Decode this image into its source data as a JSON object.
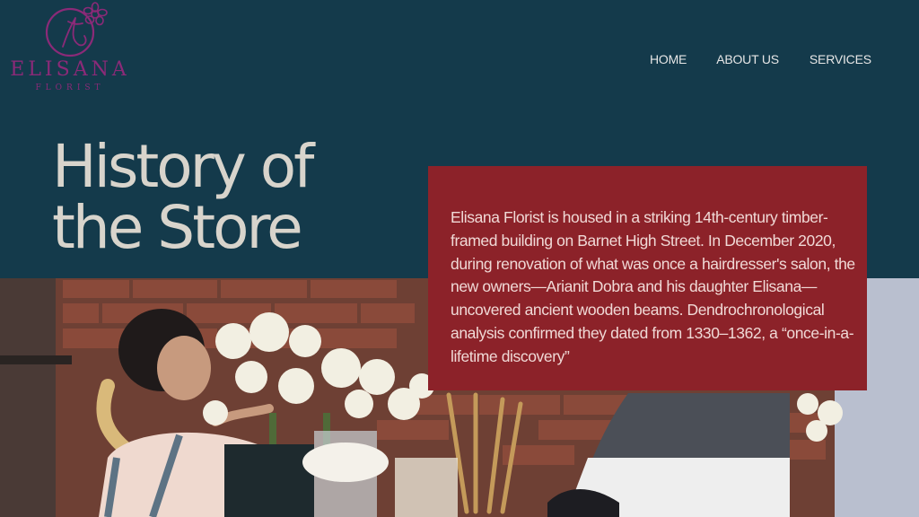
{
  "brand": {
    "name": "ELISANA",
    "tagline": "FLORIST",
    "logo_color": "#8b2a78"
  },
  "nav": {
    "items": [
      {
        "label": "HOME"
      },
      {
        "label": "ABOUT US"
      },
      {
        "label": "SERVICES"
      }
    ]
  },
  "hero": {
    "title_line1": "History of",
    "title_line2": "the Store",
    "body": "Elisana Florist is housed in a striking 14th-century timber-framed building on Barnet High Street. In December 2020, during renovation of what was once a hairdresser's salon, the new owners—Arianit Dobra and his daughter Elisana—uncovered ancient wooden beams. Dendrochronological analysis confirmed they dated from 1330–1362, a “once-in-a-lifetime discovery”"
  },
  "colors": {
    "header_bg": "#143a4b",
    "box_bg": "#8c2229",
    "title_text": "#d8d4cc"
  },
  "icons": {
    "logo": "flower-monogram-icon"
  }
}
